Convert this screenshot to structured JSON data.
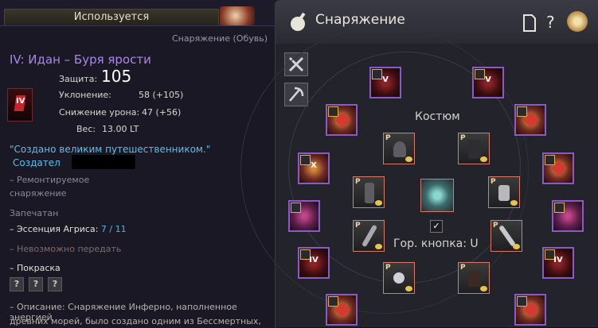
{
  "tooltip": {
    "in_use_label": "Используется",
    "category": "Снаряжение (Обувь)",
    "item_name": "IV: Идан – Буря ярости",
    "icon_text": "IV",
    "defense_label": "Защита:",
    "defense_value": "105",
    "evasion_label": "Уклонение:",
    "evasion_value": "58 (+105)",
    "dr_label": "Снижение урона:",
    "dr_value": "47 (+56)",
    "weight_label": "Вес:",
    "weight_value": "13.00 LT",
    "quote": "\"Создано великим путешественником.\"",
    "creator_label": "Создател",
    "repairable_line1": "– Ремонтируемое",
    "repairable_line2": "снаряжение",
    "sealed": "Запечатан",
    "essence_label": "– Эссенция Агриса:",
    "essence_value": "7 / 11",
    "no_transfer": "– Невозможно передать",
    "dye": "– Покраска",
    "dye_slots": [
      "?",
      "?",
      "?"
    ],
    "description_line1": "– Описание: Снаряжение Инферно, наполненное энергией",
    "description_line2": "древних морей, было создано одним из Бессмертных,"
  },
  "equipment": {
    "title": "Снаряжение",
    "costume_label": "Костюм",
    "hotkey_label": "Гор. кнопка: U",
    "hotkey_checked": "✓",
    "help_symbol": "?",
    "slot_marks": [
      "V",
      "V",
      "X",
      "IV",
      "IV"
    ]
  }
}
